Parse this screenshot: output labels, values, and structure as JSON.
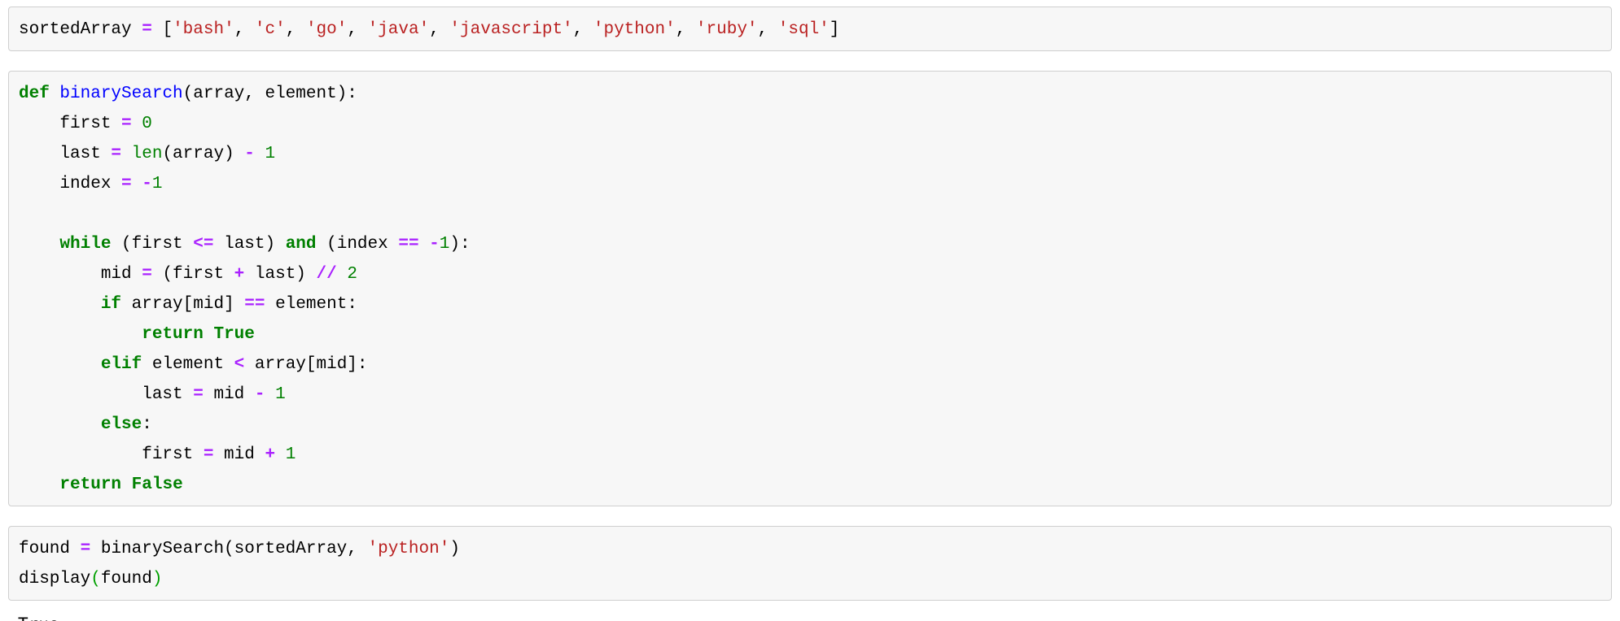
{
  "theme": {
    "cell_background": "#f7f7f7",
    "cell_border": "#cfcfcf",
    "page_background": "#ffffff",
    "keyword_color": "#008000",
    "function_color": "#0000FF",
    "operator_color": "#AA22FF",
    "string_color": "#BA2121",
    "number_color": "#008000",
    "text_color": "#000000"
  },
  "cells": [
    {
      "id": "cell-array-definition",
      "type": "code",
      "source": "sortedArray = ['bash', 'c', 'go', 'java', 'javascript', 'python', 'ruby', 'sql']",
      "tokens": [
        {
          "t": "sortedArray ",
          "c": "n"
        },
        {
          "t": "=",
          "c": "o"
        },
        {
          "t": " [",
          "c": "p"
        },
        {
          "t": "'bash'",
          "c": "s"
        },
        {
          "t": ", ",
          "c": "p"
        },
        {
          "t": "'c'",
          "c": "s"
        },
        {
          "t": ", ",
          "c": "p"
        },
        {
          "t": "'go'",
          "c": "s"
        },
        {
          "t": ", ",
          "c": "p"
        },
        {
          "t": "'java'",
          "c": "s"
        },
        {
          "t": ", ",
          "c": "p"
        },
        {
          "t": "'javascript'",
          "c": "s"
        },
        {
          "t": ", ",
          "c": "p"
        },
        {
          "t": "'python'",
          "c": "s"
        },
        {
          "t": ", ",
          "c": "p"
        },
        {
          "t": "'ruby'",
          "c": "s"
        },
        {
          "t": ", ",
          "c": "p"
        },
        {
          "t": "'sql'",
          "c": "s"
        },
        {
          "t": "]",
          "c": "p"
        }
      ]
    },
    {
      "id": "cell-binary-search-function",
      "type": "code",
      "source": "def binarySearch(array, element):\n    first = 0\n    last = len(array) - 1\n    index = -1\n\n    while (first <= last) and (index == -1):\n        mid = (first + last) // 2\n        if array[mid] == element:\n            return True\n        elif element < array[mid]:\n            last = mid - 1\n        else:\n            first = mid + 1\n    return False",
      "lines": [
        [
          {
            "t": "def",
            "c": "k"
          },
          {
            "t": " ",
            "c": "p"
          },
          {
            "t": "binarySearch",
            "c": "nf"
          },
          {
            "t": "(array, element):",
            "c": "p"
          }
        ],
        [
          {
            "t": "    first ",
            "c": "n"
          },
          {
            "t": "=",
            "c": "o"
          },
          {
            "t": " ",
            "c": "p"
          },
          {
            "t": "0",
            "c": "mi"
          }
        ],
        [
          {
            "t": "    last ",
            "c": "n"
          },
          {
            "t": "=",
            "c": "o"
          },
          {
            "t": " ",
            "c": "p"
          },
          {
            "t": "len",
            "c": "nb"
          },
          {
            "t": "(array) ",
            "c": "p"
          },
          {
            "t": "-",
            "c": "o"
          },
          {
            "t": " ",
            "c": "p"
          },
          {
            "t": "1",
            "c": "mi"
          }
        ],
        [
          {
            "t": "    index ",
            "c": "n"
          },
          {
            "t": "=",
            "c": "o"
          },
          {
            "t": " ",
            "c": "p"
          },
          {
            "t": "-",
            "c": "o"
          },
          {
            "t": "1",
            "c": "mi"
          }
        ],
        [
          {
            "t": "",
            "c": "p"
          }
        ],
        [
          {
            "t": "    ",
            "c": "p"
          },
          {
            "t": "while",
            "c": "k"
          },
          {
            "t": " (first ",
            "c": "p"
          },
          {
            "t": "<=",
            "c": "o"
          },
          {
            "t": " last) ",
            "c": "p"
          },
          {
            "t": "and",
            "c": "k"
          },
          {
            "t": " (index ",
            "c": "p"
          },
          {
            "t": "==",
            "c": "o"
          },
          {
            "t": " ",
            "c": "p"
          },
          {
            "t": "-",
            "c": "o"
          },
          {
            "t": "1",
            "c": "mi"
          },
          {
            "t": "):",
            "c": "p"
          }
        ],
        [
          {
            "t": "        mid ",
            "c": "n"
          },
          {
            "t": "=",
            "c": "o"
          },
          {
            "t": " (first ",
            "c": "p"
          },
          {
            "t": "+",
            "c": "o"
          },
          {
            "t": " last) ",
            "c": "p"
          },
          {
            "t": "//",
            "c": "o"
          },
          {
            "t": " ",
            "c": "p"
          },
          {
            "t": "2",
            "c": "mi"
          }
        ],
        [
          {
            "t": "        ",
            "c": "p"
          },
          {
            "t": "if",
            "c": "k"
          },
          {
            "t": " array[mid] ",
            "c": "p"
          },
          {
            "t": "==",
            "c": "o"
          },
          {
            "t": " element:",
            "c": "p"
          }
        ],
        [
          {
            "t": "            ",
            "c": "p"
          },
          {
            "t": "return",
            "c": "k"
          },
          {
            "t": " ",
            "c": "p"
          },
          {
            "t": "True",
            "c": "kc"
          }
        ],
        [
          {
            "t": "        ",
            "c": "p"
          },
          {
            "t": "elif",
            "c": "k"
          },
          {
            "t": " element ",
            "c": "p"
          },
          {
            "t": "<",
            "c": "o"
          },
          {
            "t": " array[mid]:",
            "c": "p"
          }
        ],
        [
          {
            "t": "            last ",
            "c": "n"
          },
          {
            "t": "=",
            "c": "o"
          },
          {
            "t": " mid ",
            "c": "p"
          },
          {
            "t": "-",
            "c": "o"
          },
          {
            "t": " ",
            "c": "p"
          },
          {
            "t": "1",
            "c": "mi"
          }
        ],
        [
          {
            "t": "        ",
            "c": "p"
          },
          {
            "t": "else",
            "c": "k"
          },
          {
            "t": ":",
            "c": "p"
          }
        ],
        [
          {
            "t": "            first ",
            "c": "n"
          },
          {
            "t": "=",
            "c": "o"
          },
          {
            "t": " mid ",
            "c": "p"
          },
          {
            "t": "+",
            "c": "o"
          },
          {
            "t": " ",
            "c": "p"
          },
          {
            "t": "1",
            "c": "mi"
          }
        ],
        [
          {
            "t": "    ",
            "c": "p"
          },
          {
            "t": "return",
            "c": "k"
          },
          {
            "t": " ",
            "c": "p"
          },
          {
            "t": "False",
            "c": "kc"
          }
        ]
      ]
    },
    {
      "id": "cell-invoke-search",
      "type": "code",
      "source": "found = binarySearch(sortedArray, 'python')\ndisplay(found)",
      "lines": [
        [
          {
            "t": "found ",
            "c": "n"
          },
          {
            "t": "=",
            "c": "o"
          },
          {
            "t": " binarySearch(sortedArray, ",
            "c": "p"
          },
          {
            "t": "'python'",
            "c": "s"
          },
          {
            "t": ")",
            "c": "p"
          }
        ],
        [
          {
            "t": "display",
            "c": "n"
          },
          {
            "t": "(",
            "c": "gr"
          },
          {
            "t": "found",
            "c": "n"
          },
          {
            "t": ")",
            "c": "gr"
          }
        ]
      ]
    }
  ],
  "output": {
    "id": "output-result",
    "text": "True"
  }
}
